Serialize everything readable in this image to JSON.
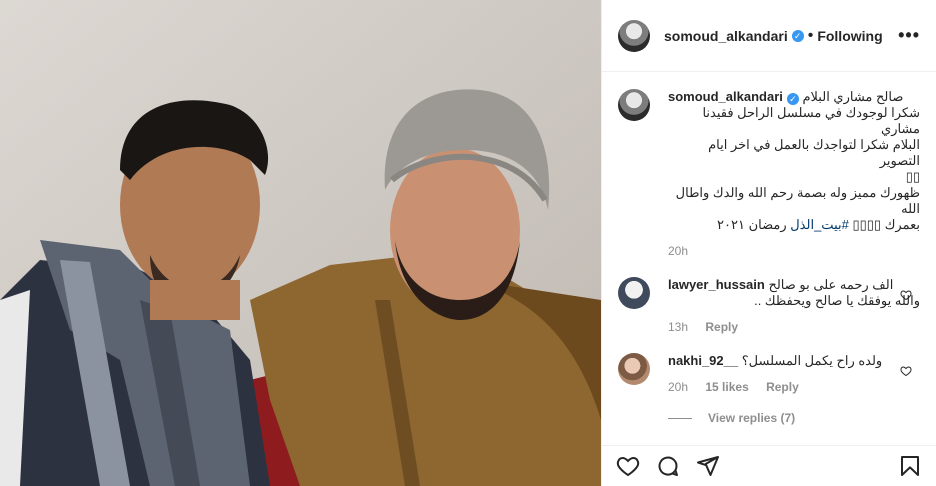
{
  "post": {
    "username": "somoud_alkandari",
    "follow_status": "Following",
    "more_icon": "more-horizontal-icon"
  },
  "caption": {
    "username": "somoud_alkandari",
    "text_line1": "صالح مشاري البلام",
    "text_line2": "شكرا لوجودك في مسلسل الراحل فقيدنا مشاري",
    "text_line3": "البلام شكرا لتواجدك بالعمل في اخر ايام التصوير",
    "text_line4": "▯▯",
    "text_line5": "ظهورك مميز وله بصمة رحم الله والدك واطال الله",
    "text_line6_prefix": "بعمرك ▯▯▯▯",
    "hashtag": "#بيت_الذل",
    "text_line6_suffix": "رمضان ٢٠٢١",
    "time": "20h"
  },
  "comments": [
    {
      "username": "lawyer_hussain",
      "text_line1": "الف رحمه على بو صالح",
      "text_line2": "والله يوفقك يا صالح ويحفظك ..",
      "time": "13h",
      "reply": "Reply"
    },
    {
      "username": "nakhi_92__",
      "text": "ولده راح يكمل المسلسل؟",
      "time": "20h",
      "likes": "15 likes",
      "reply": "Reply",
      "view_replies": "View replies (7)"
    }
  ],
  "colors": {
    "verified": "#3897f0",
    "muted": "#8e8e8e",
    "text": "#262626",
    "hashtag": "#00376b"
  }
}
